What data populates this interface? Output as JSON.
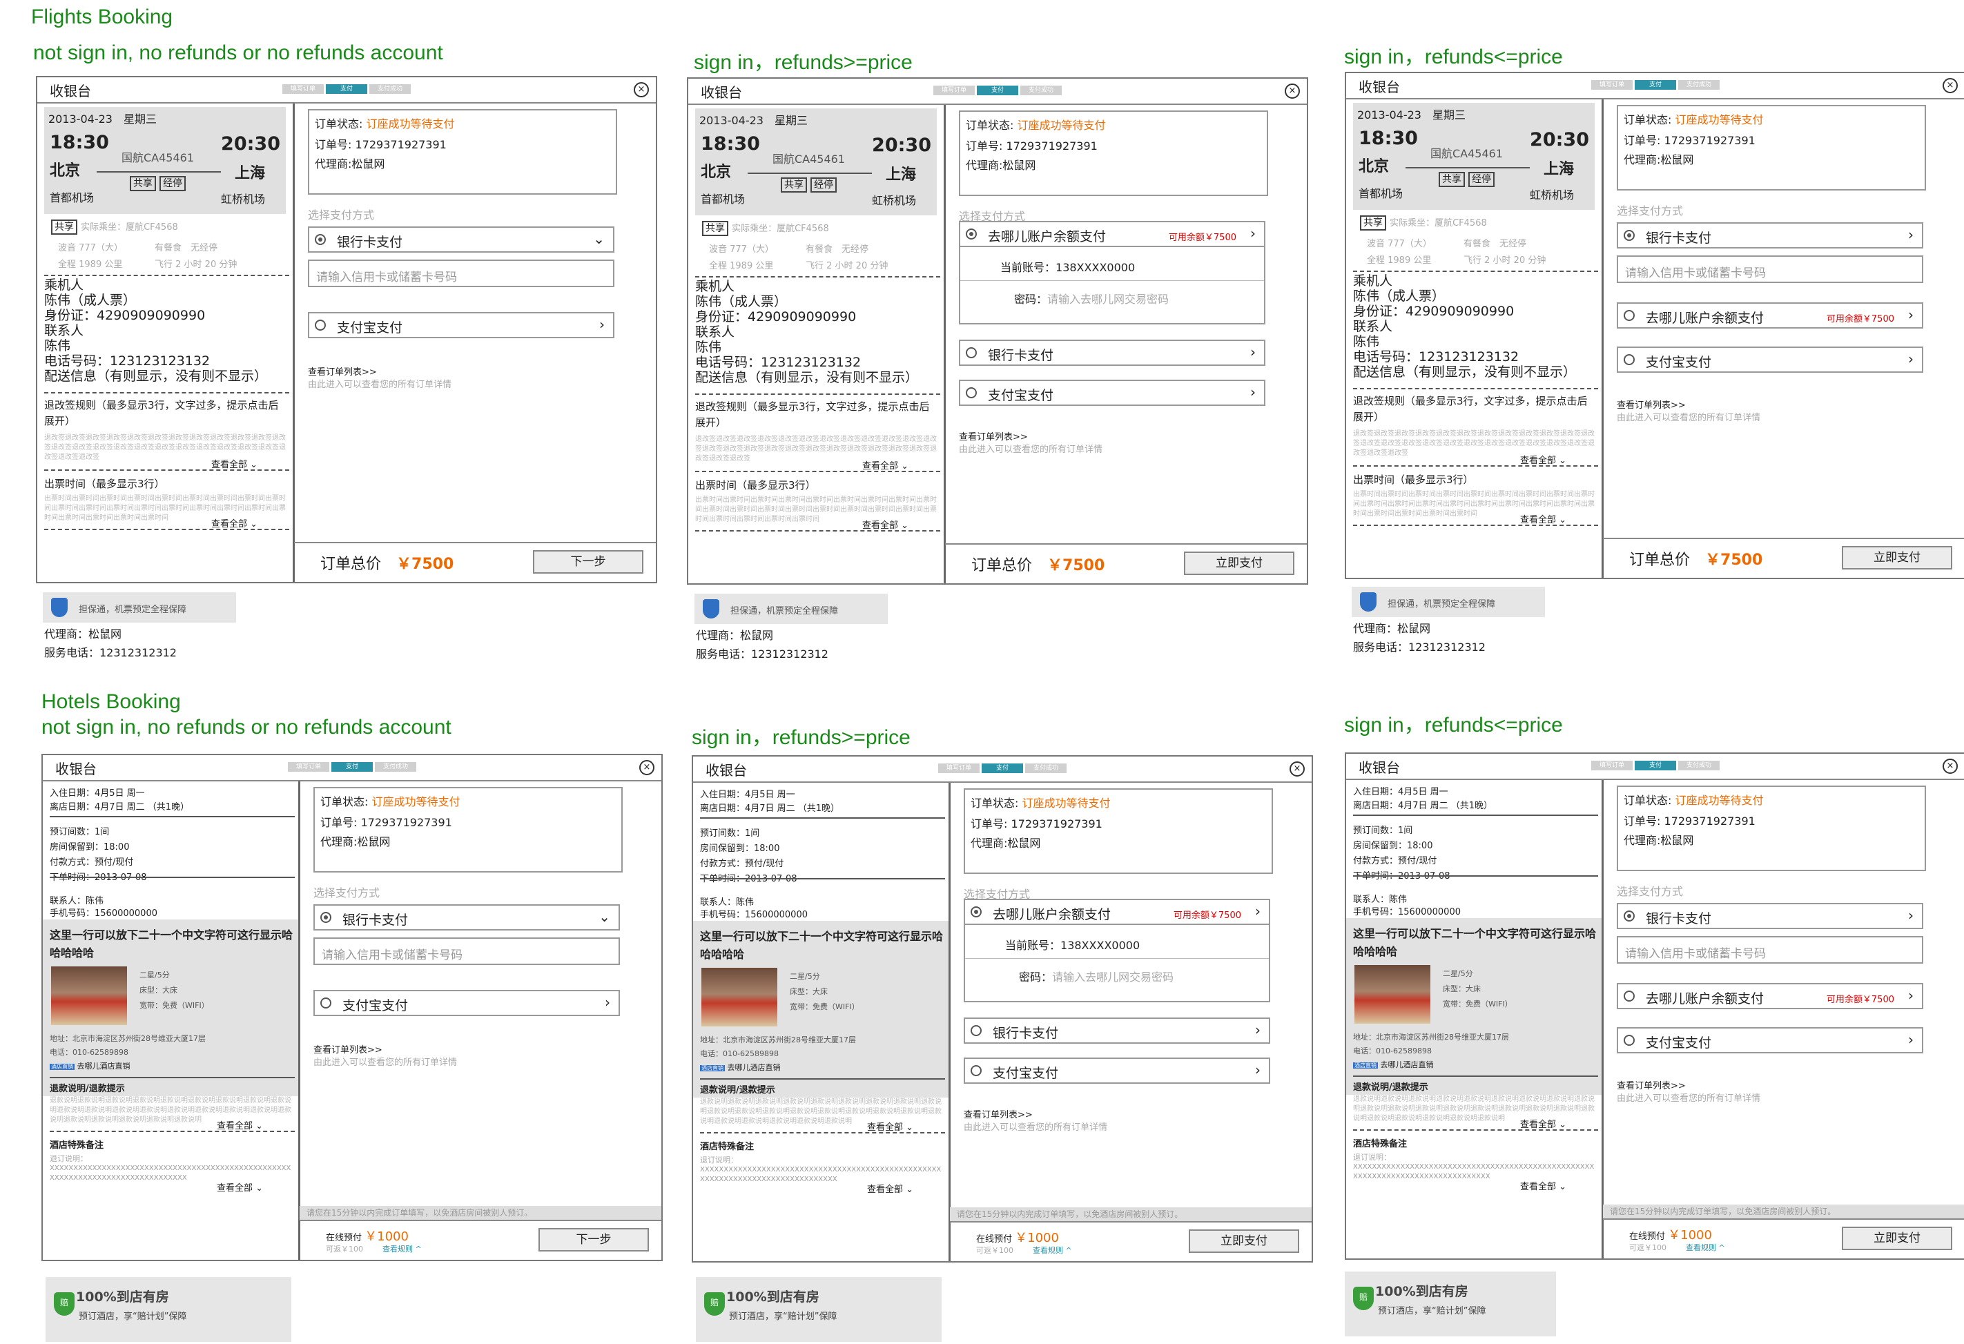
{
  "headings": {
    "flights": "Flights Booking",
    "hotels": "Hotels Booking",
    "no_account": "not sign in, no refunds or no refunds account",
    "refunds_gte": "sign in，refunds>=price",
    "refunds_lte": "sign in，refunds<=price"
  },
  "common": {
    "cashier": "收银台",
    "close": "×",
    "steps": [
      "填写订单",
      "支付",
      "支付成功"
    ],
    "order_status_label": "订单状态:",
    "order_status": "订座成功等待支付",
    "order_no_label": "订单号:",
    "order_no": "1729371927391",
    "agent_label": "代理商:",
    "agent": "松鼠网",
    "choose_method": "选择支付方式",
    "bank_card": "银行卡支付",
    "card_placeholder": "请输入信用卡或储蓄卡号码",
    "alipay": "支付宝支付",
    "qunar_balance": "去哪儿账户余额支付",
    "balance_avail": "可用余额￥7500",
    "current_account_label": "当前账号：",
    "current_account": "138XXXX0000",
    "password_label": "密码：",
    "password_placeholder": "请输入去哪儿网交易密码",
    "order_list_link": "查看订单列表>>",
    "order_list_desc": "由此进入可以查看您的所有订单详情",
    "next_step": "下一步",
    "pay_now": "立即支付",
    "arrow": "›",
    "chevron_down": "⌄",
    "see_all": "查看全部"
  },
  "flight": {
    "date": "2013-04-23",
    "weekday": "星期三",
    "dep_time": "18:30",
    "arr_time": "20:30",
    "dep_city": "北京",
    "arr_city": "上海",
    "flight_no": "国航CA45461",
    "dep_airport": "首都机场",
    "arr_airport": "虹桥机场",
    "tag_share": "共享",
    "tag_stop": "经停",
    "actual_carrier": "实际乘坐：厦航CF4568",
    "plane": "波音 777（大）",
    "meal": "有餐食",
    "wifi": "无经停",
    "distance": "全程 1989 公里",
    "duration": "飞行 2 小时 20 分钟",
    "passenger_title": "乘机人",
    "passenger": "陈伟（成人票）",
    "id_label": "身份证：",
    "id_no": "4290909090990",
    "contact_title": "联系人",
    "contact": "陈伟",
    "phone_label": "电话号码：",
    "phone": "123123123132",
    "delivery": "配送信息（有则显示，没有则不显示）",
    "rules_title": "退改签规则（最多显示3行，文字过多，提示点击后展开）",
    "rules_text": "退改签退改签退改签退改签退改签退改签退改签退改签退改签退改签退改签退改签退改签退改签退改签退改签退改签退改签退改签退改签退改签退改签退改签退改签退改签退改签",
    "ticket_title": "出票时间（最多显示3行）",
    "ticket_text": "出票时间出票时间出票时间出票时间出票时间出票时间出票时间出票时间出票时间出票时间出票时间出票时间出票时间出票时间出票时间出票时间出票时间出票时间出票时间出票时间出票时间出票时间",
    "total_label": "订单总价",
    "total": "￥7500",
    "guarantee": "担保通，机票预定全程保障",
    "agent_line": "代理商：松鼠网",
    "service_phone": "服务电话：12312312312"
  },
  "hotel": {
    "checkin": "入住日期：4月5日 周一",
    "checkout": "离店日期：4月7日 周二 （共1晚）",
    "rooms": "预订间数：1间",
    "hold": "房间保留到：18:00",
    "payment": "付款方式：预付/现付",
    "order_time": "下单时间：2013-07-08",
    "contact": "联系人：陈伟",
    "mobile": "手机号码：15600000000",
    "name": "这里一行可以放下二十一个中文字符可这行显示哈哈哈哈哈",
    "star": "二星/5分",
    "bed": "床型：大床",
    "broadband": "宽带：免费（WIFI）",
    "address": "地址：北京市海淀区苏州街28号维亚大厦17层",
    "tel": "电话：010-62589898",
    "direct_badge": "酒店直销",
    "direct": "去哪儿酒店直销",
    "refund_title": "退款说明/退款提示",
    "refund_text": "退款说明退款说明退款说明退款说明退款说明退款说明退款说明退款说明退款说明退款说明退款说明退款说明退款说明退款说明退款说明退款说明退款说明退款说明退款说明退款说明退款说明退款说明退款说明",
    "notes_title": "酒店特殊备注",
    "notes_label": "退订说明：",
    "notes_text": "XXXXXXXXXXXXXXXXXXXXXXXXXXXXXXXXXXXXXXXXXXXXXXXXXXXXXXXXXXXXXXXXXXXXXXXXXXXXXXXX",
    "warn": "请您在15分钟以内完成订单填写，以免酒店房间被别人预订。",
    "online_label": "在线预付",
    "online_price": "￥1000",
    "refundable": "可返￥100",
    "rules_link": "查看规则 ^",
    "badge_title": "100%到店有房",
    "badge_sub": "预订酒店，享“赔计划”保障",
    "badge_icon": "赔"
  },
  "colors": {
    "heading": "#1a8a1a",
    "accent": "#ee6a00",
    "balance": "#dd0000",
    "step_active": "#2a93a8"
  }
}
